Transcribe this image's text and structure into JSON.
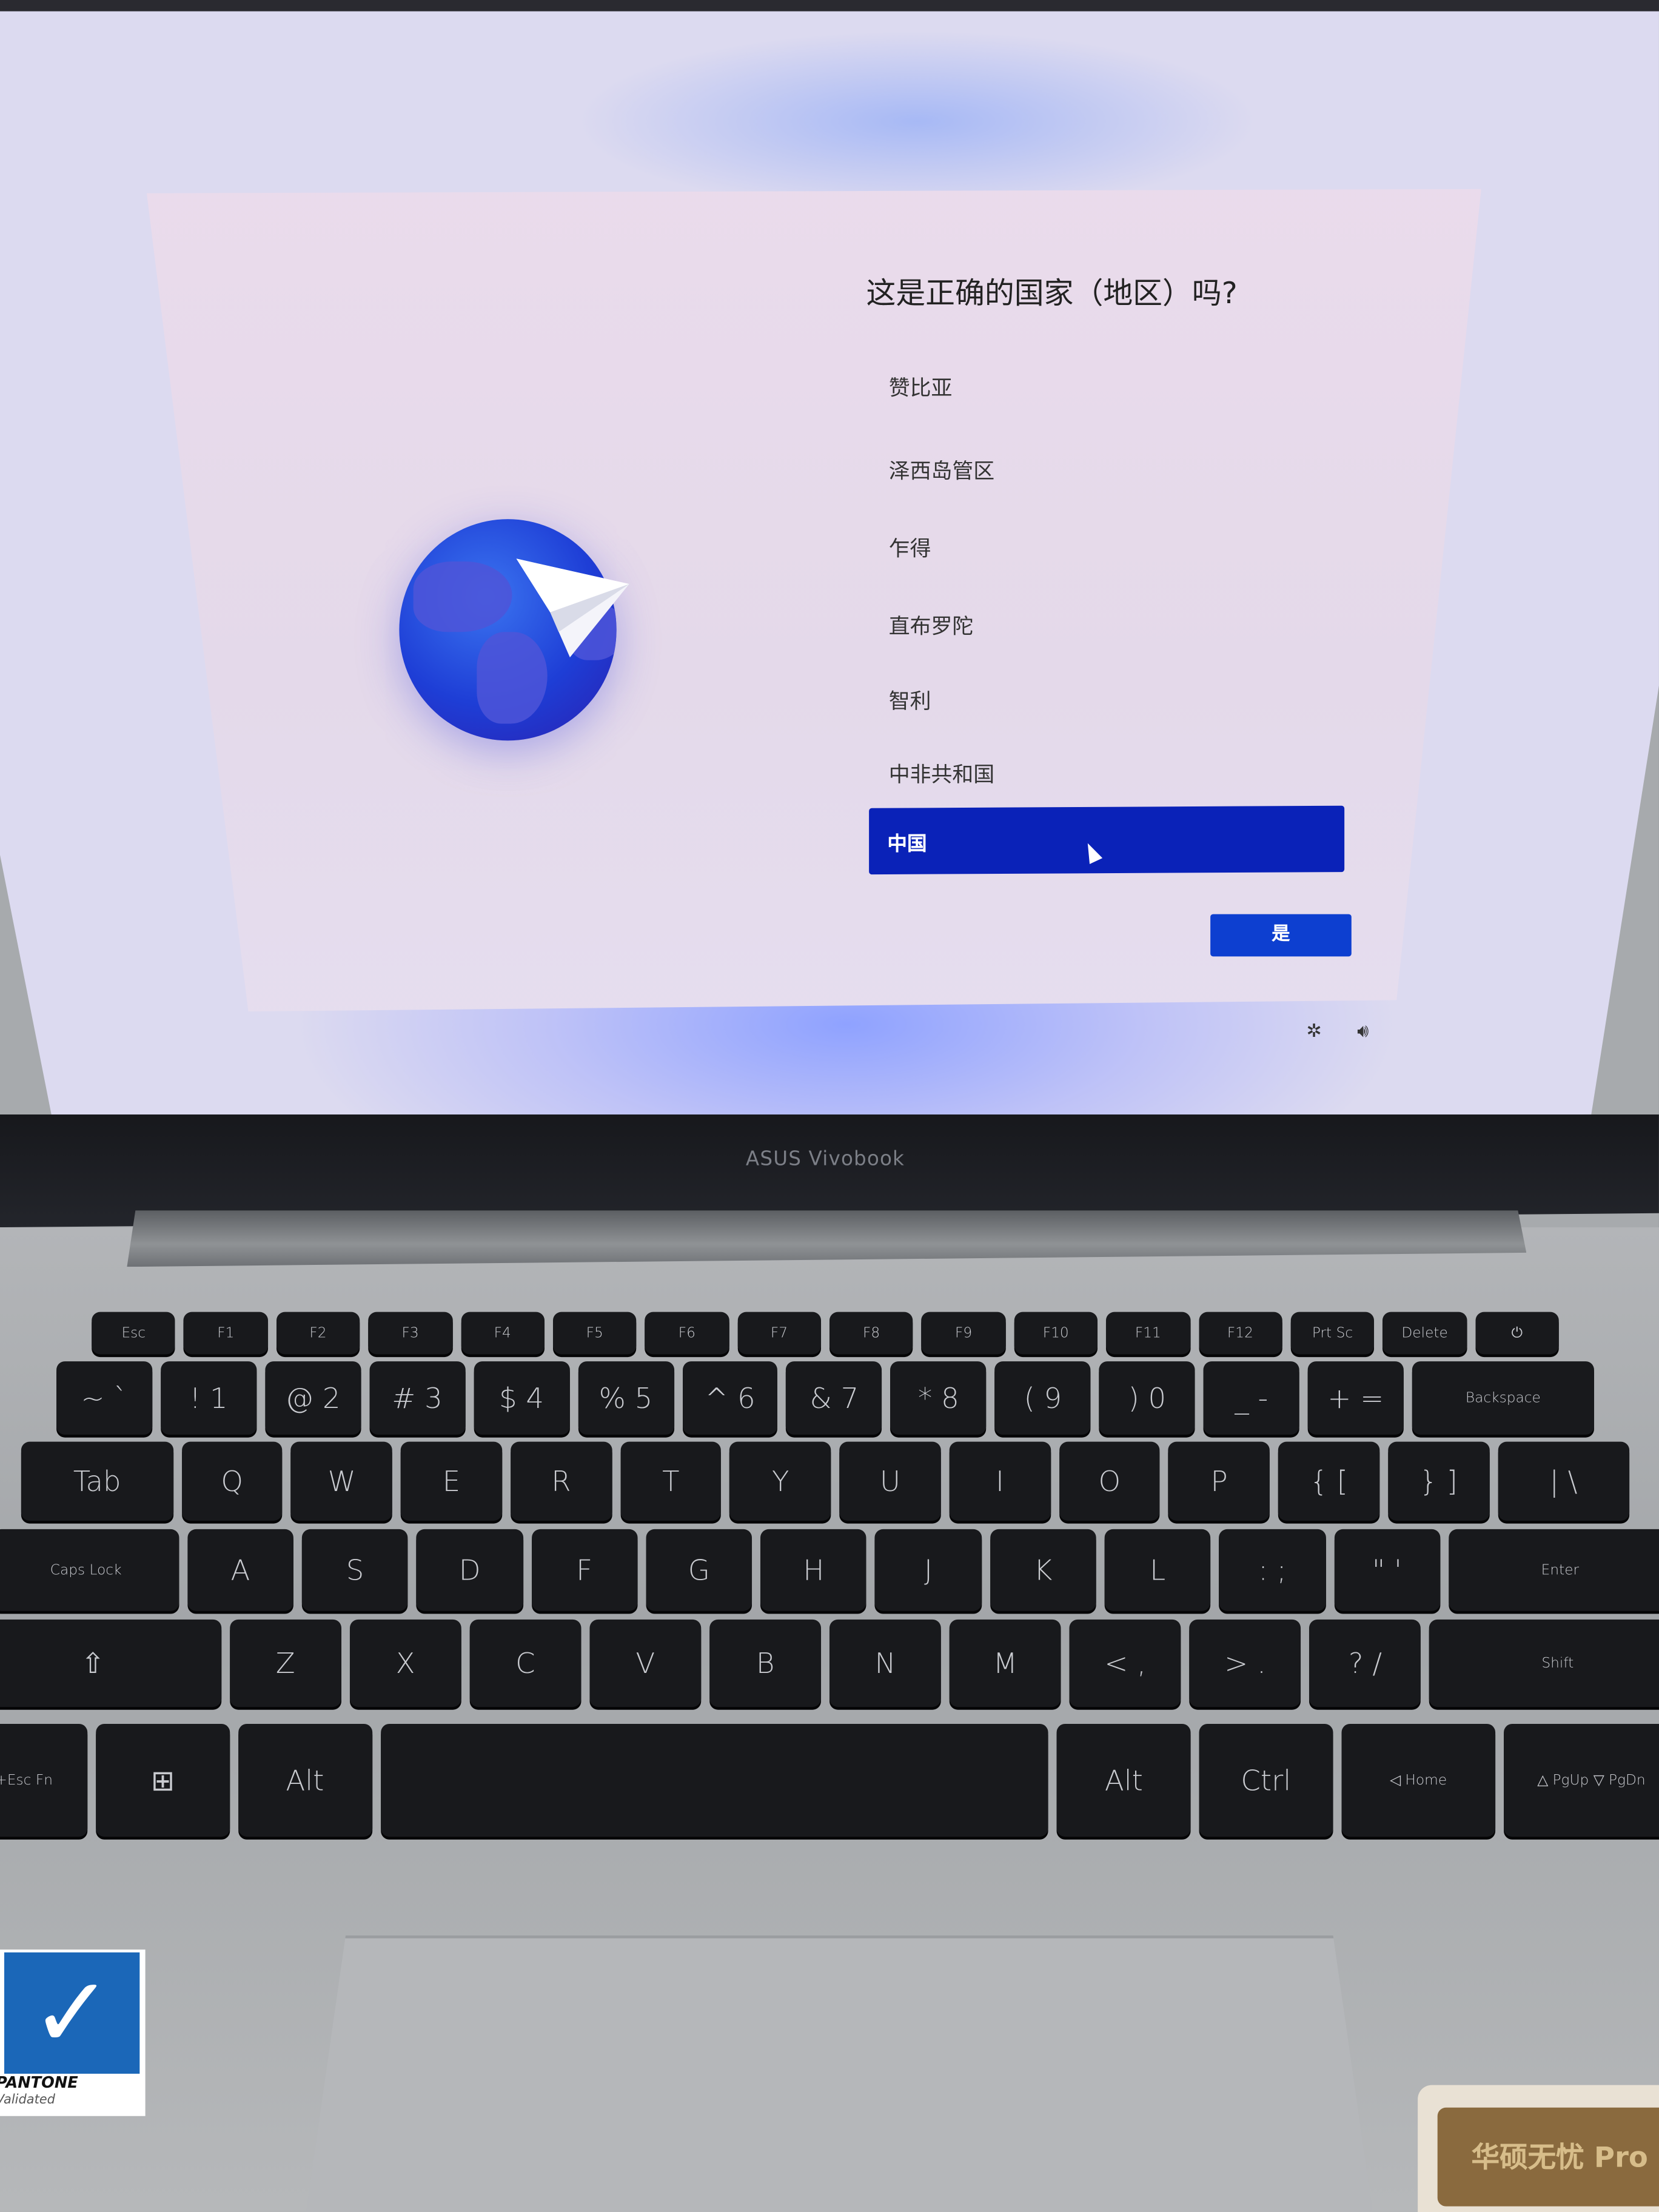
{
  "dialog": {
    "title": "这是正确的国家（地区）吗?",
    "countries": [
      "赞比亚",
      "泽西岛管区",
      "乍得",
      "直布罗陀",
      "智利",
      "中非共和国",
      "中国"
    ],
    "selected": "中国",
    "confirm_label": "是",
    "accent_color": "#0a22b8"
  },
  "system_icons": {
    "accessibility": "accessibility-icon",
    "volume": "volume-icon"
  },
  "laptop": {
    "brand": "ASUS Vivobook"
  },
  "keyboard": {
    "rows": [
      [
        "Esc",
        "F1",
        "F2",
        "F3",
        "F4",
        "F5",
        "F6",
        "F7",
        "F8",
        "F9",
        "F10",
        "F11",
        "F12",
        "Prt Sc",
        "Delete",
        "⏻"
      ],
      [
        "~ `",
        "! 1",
        "@ 2",
        "# 3",
        "$ 4",
        "% 5",
        "^ 6",
        "& 7",
        "* 8",
        "( 9",
        ") 0",
        "_ -",
        "+ =",
        "Backspace"
      ],
      [
        "Tab",
        "Q",
        "W",
        "E",
        "R",
        "T",
        "Y",
        "U",
        "I",
        "O",
        "P",
        "{ [",
        "} ]",
        "| \\"
      ],
      [
        "Caps Lock",
        "A",
        "S",
        "D",
        "F",
        "G",
        "H",
        "J",
        "K",
        "L",
        ": ;",
        "\" '",
        "Enter"
      ],
      [
        "⇧",
        "Z",
        "X",
        "C",
        "V",
        "B",
        "N",
        "M",
        "< ,",
        "> .",
        "? /",
        "Shift"
      ],
      [
        "Fn+Esc Fn",
        "⊞",
        "Alt",
        "",
        "Alt",
        "Ctrl",
        "◁ Home",
        "△ PgUp ▽ PgDn"
      ]
    ]
  },
  "stickers": {
    "pantone": "PANTONE",
    "pantone_sub": "Validated",
    "right": "华硕无忧 Pro"
  }
}
